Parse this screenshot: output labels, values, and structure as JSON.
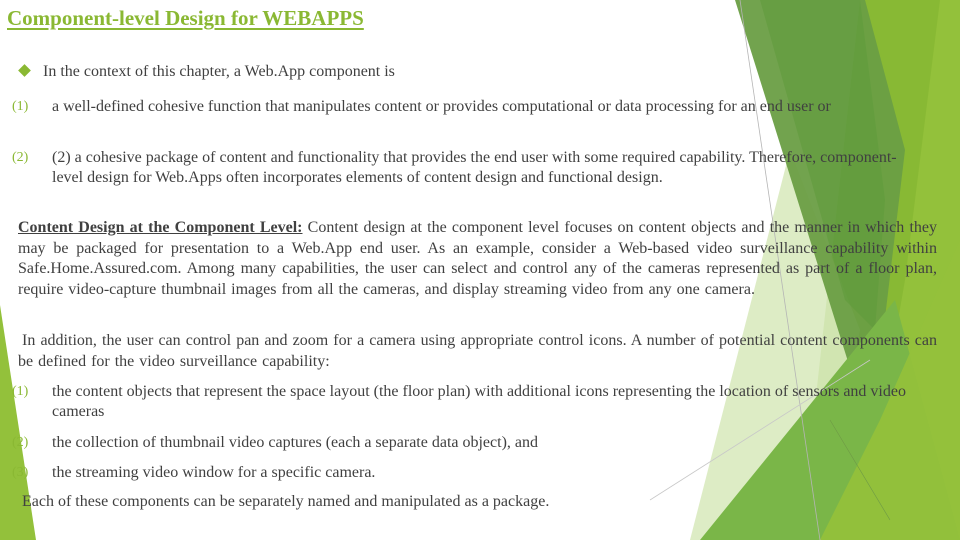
{
  "slide": {
    "title": "Component-level Design for WEBAPPS",
    "intro_bullet": {
      "icon": "diamond-bullet-icon",
      "text": "In the context of this chapter, a Web.App component is"
    },
    "definitions": [
      {
        "number": "(1)",
        "text": "a well-defined cohesive function that manipulates content or provides computational or data processing for an end user or"
      },
      {
        "number": "(2)",
        "text": "(2) a cohesive package of content and functionality that provides the end user with some required capability. Therefore, component-level design for Web.Apps often incorporates elements of content design and functional design."
      }
    ],
    "content_design": {
      "heading": "Content Design at the Component Level:",
      "body": " Content design at the component level focuses on content objects and the manner in which they may be packaged for presentation to a Web.App end user. As an example, consider a Web-based video surveillance capability within Safe.Home.Assured.com. Among many capabilities, the user can select and control any of the cameras represented as part of a floor plan, require video-capture thumbnail images from all the cameras, and display streaming video from any one camera."
    },
    "addition_paragraph": "In addition, the user can control pan and zoom for a camera using appropriate control icons. A number of potential content components can be defined for the video surveillance capability:",
    "components": [
      {
        "number": "(1)",
        "text": "the content objects that represent the space layout (the floor plan) with additional icons representing the location of sensors and video cameras"
      },
      {
        "number": "(2)",
        "text": "the collection of thumbnail video captures (each a separate data object), and"
      },
      {
        "number": "(3)",
        "text": "the streaming video window for a specific camera."
      }
    ],
    "closing": "Each of these components can be separately named and manipulated as a package."
  },
  "theme": {
    "accent": "#8AB833",
    "text": "#404040",
    "facet_dark": "#5E9B3A",
    "facet_mid": "#7AB648",
    "facet_light": "#93C13B",
    "facet_pale": "#D9EABF"
  }
}
